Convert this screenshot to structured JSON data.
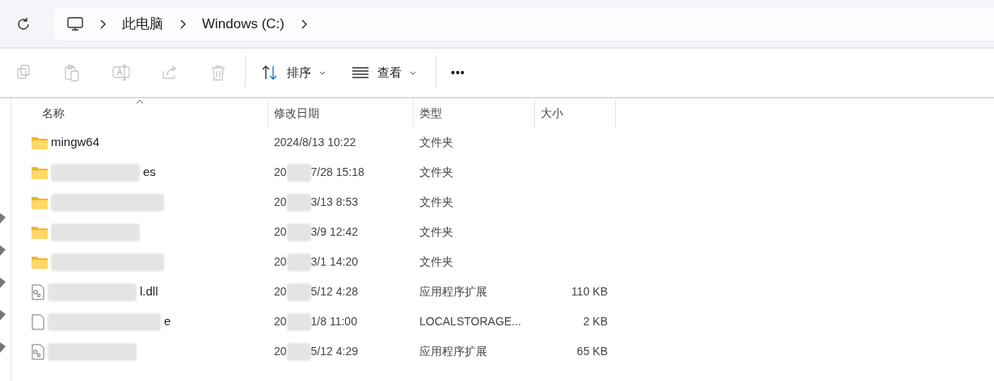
{
  "address_bar": {
    "crumbs": [
      "此电脑",
      "Windows (C:)"
    ]
  },
  "toolbar": {
    "actions": [
      {
        "kind": "copy",
        "disabled": true
      },
      {
        "kind": "paste",
        "disabled": true
      },
      {
        "kind": "rename",
        "disabled": true
      },
      {
        "kind": "share",
        "disabled": true
      },
      {
        "kind": "delete",
        "disabled": true
      }
    ],
    "sort": "排序",
    "view": "查看",
    "more": "•••"
  },
  "table": {
    "columns": [
      {
        "label": "名称",
        "sorted": true
      },
      {
        "label": "修改日期",
        "sorted": false
      },
      {
        "label": "类型",
        "sorted": false
      },
      {
        "label": "大小",
        "sorted": false
      }
    ],
    "rows": [
      {
        "kind": "folder",
        "name": "mingw64",
        "name_redacted": false,
        "date": [
          "2024/8/13 10:22"
        ],
        "type": "文件夹"
      },
      {
        "kind": "folder",
        "name": "es",
        "name_redacted": true,
        "date": [
          "20",
          "7/28 15:18"
        ],
        "type": "文件夹"
      },
      {
        "kind": "folder",
        "name_redacted": true,
        "date": [
          "20",
          "3/13 8:53"
        ],
        "type": "文件夹"
      },
      {
        "kind": "folder",
        "name_redacted": true,
        "date": [
          "20",
          "3/9 12:42"
        ],
        "type": "文件夹"
      },
      {
        "kind": "folder",
        "name_redacted": true,
        "date": [
          "20",
          "3/1 14:20"
        ],
        "type": "文件夹"
      },
      {
        "kind": "dll",
        "name": "l.dll",
        "name_redacted": true,
        "date": [
          "20",
          "5/12 4:28"
        ],
        "type": "应用程序扩展",
        "size": "110 KB"
      },
      {
        "kind": "file",
        "name": "e",
        "name_redacted": true,
        "date": [
          "20",
          "1/8 11:00"
        ],
        "type": "LOCALSTORAGE...",
        "size": "2 KB"
      },
      {
        "kind": "dll",
        "name_redacted": true,
        "date": [
          "20",
          "5/12 4:29"
        ],
        "type": "应用程序扩展",
        "size": "65 KB"
      }
    ]
  }
}
